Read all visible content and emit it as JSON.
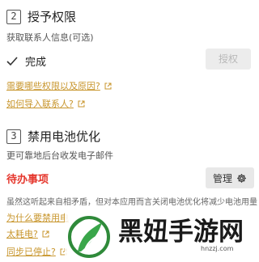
{
  "section2": {
    "number": "2",
    "title": "授予权限",
    "desc": "获取联系人信息(可选)",
    "status_label": "完成",
    "grant_button": "授权",
    "link_why": "需要哪些权限以及原因?",
    "link_import": "如何导入联系人?"
  },
  "section3": {
    "number": "3",
    "title": "禁用电池优化",
    "desc": "更可靠地后台收发电子邮件",
    "todo_label": "待办事项",
    "manage_button": "管理",
    "long_text": "虽然这听起来自相矛盾，但对本应用而言关闭电池优化将减少电池用量",
    "link_why_disable": "为什么要禁用电",
    "link_drain": "太耗电?",
    "link_sync": "同步已停止?"
  },
  "watermark": {
    "text": "黑妞手游网",
    "url": "hnzzj.com"
  },
  "colors": {
    "link": "#c8962d",
    "todo": "#e5362c",
    "disabled_button_text": "#b8b8b8"
  },
  "icons": {
    "done": "check-icon",
    "external": "external-link-icon",
    "manage": "gear-icon"
  }
}
